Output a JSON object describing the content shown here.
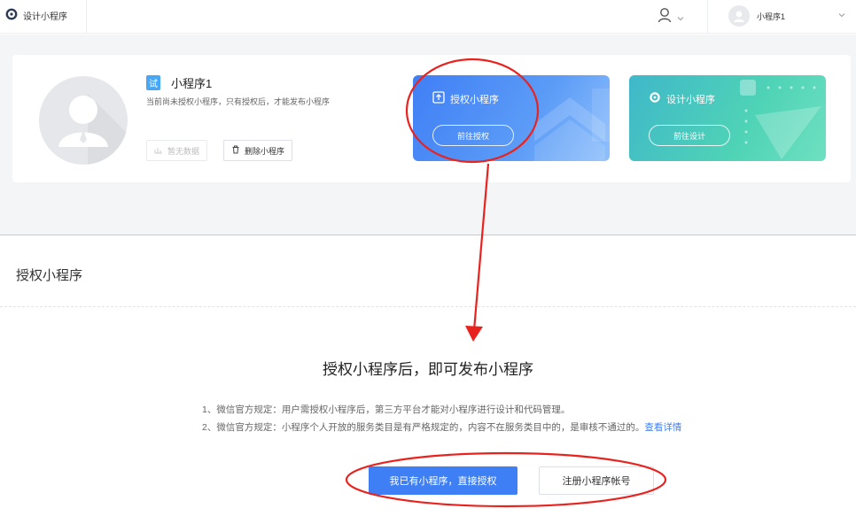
{
  "topbar": {
    "brand_label": "设计小程序",
    "account_name": "小程序1"
  },
  "profile": {
    "test_badge": "试",
    "app_name": "小程序1",
    "description": "当前尚未授权小程序，只有授权后，才能发布小程序",
    "no_data_label": "暂无数据",
    "delete_label": "删除小程序"
  },
  "panels": {
    "auth": {
      "title": "授权小程序",
      "button": "前往授权"
    },
    "design": {
      "title": "设计小程序",
      "button": "前往设计"
    }
  },
  "section": {
    "title": "授权小程序",
    "headline": "授权小程序后，即可发布小程序",
    "rule1": "1、微信官方规定：用户需授权小程序后，第三方平台才能对小程序进行设计和代码管理。",
    "rule2": "2、微信官方规定：小程序个人开放的服务类目是有严格规定的，内容不在服务类目中的，是审核不通过的。",
    "detail_link": "查看详情",
    "primary_button": "我已有小程序，直接授权",
    "register_button": "注册小程序帐号"
  },
  "icons": [
    "logo-icon",
    "user-icon",
    "chevron-down-icon",
    "chart-icon",
    "trash-icon",
    "upload-icon",
    "gear-icon"
  ],
  "colors": {
    "accent": "#3f7ff5",
    "auth_panel": "#4a8af6",
    "design_panel": "#45c6c0",
    "annotation": "#e8231f",
    "test_badge": "#47a7f5"
  }
}
